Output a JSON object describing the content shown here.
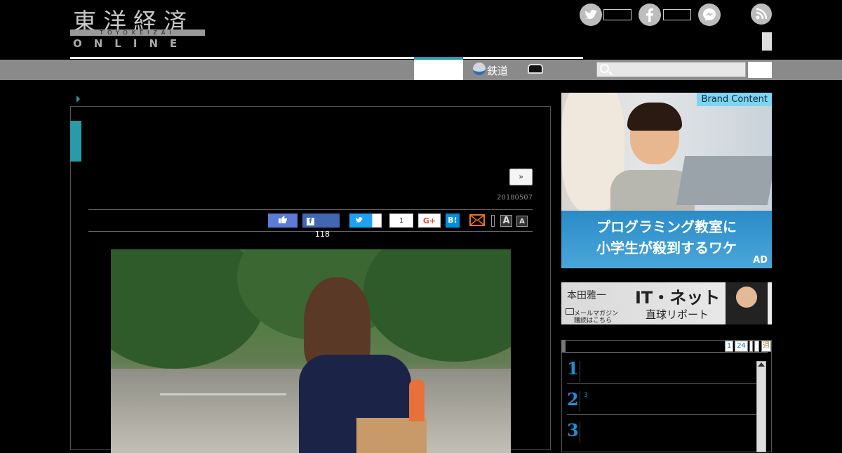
{
  "header": {
    "logo_kanji": "東洋経済",
    "logo_romaji": "TOYOKEIZAI",
    "logo_online": "ONLINE",
    "social": {
      "twitter_icon": "t",
      "facebook_icon": "f",
      "messenger_icon": "m",
      "rss_icon": "rss"
    }
  },
  "nav": {
    "items": [
      {
        "label": "鉄道",
        "icon": "train-icon"
      },
      {
        "label": "",
        "icon": "car-icon"
      }
    ],
    "search_placeholder": ""
  },
  "article": {
    "next_button": "»",
    "date": "20180507",
    "share": {
      "facebook_share_count": "118",
      "pocket_count": "1",
      "gplus_label": "G+",
      "hatena_label": "B!"
    },
    "font_size_labels": [
      "A",
      "A"
    ]
  },
  "sidebar": {
    "ad1": {
      "brand": "Brand Content",
      "line1": "プログラミング教室に",
      "line2": "小学生が殺到するワケ",
      "label": "AD"
    },
    "ad2": {
      "name": "本田雅一",
      "title": "IT・ネット",
      "subtitle": "直球リポート",
      "cta_line1": "メールマガジン",
      "cta_line2": "購読はこちら"
    },
    "ranking": {
      "tabs": [
        "1",
        "24",
        "",
        "",
        "週"
      ],
      "items": [
        {
          "rank": "1",
          "sub": ""
        },
        {
          "rank": "2",
          "sub": "3"
        },
        {
          "rank": "3",
          "sub": ""
        }
      ]
    }
  },
  "colors": {
    "accent": "#2a9aa8",
    "nav_bg": "#8a8a8a",
    "rank_blue": "#1e8fd6"
  }
}
